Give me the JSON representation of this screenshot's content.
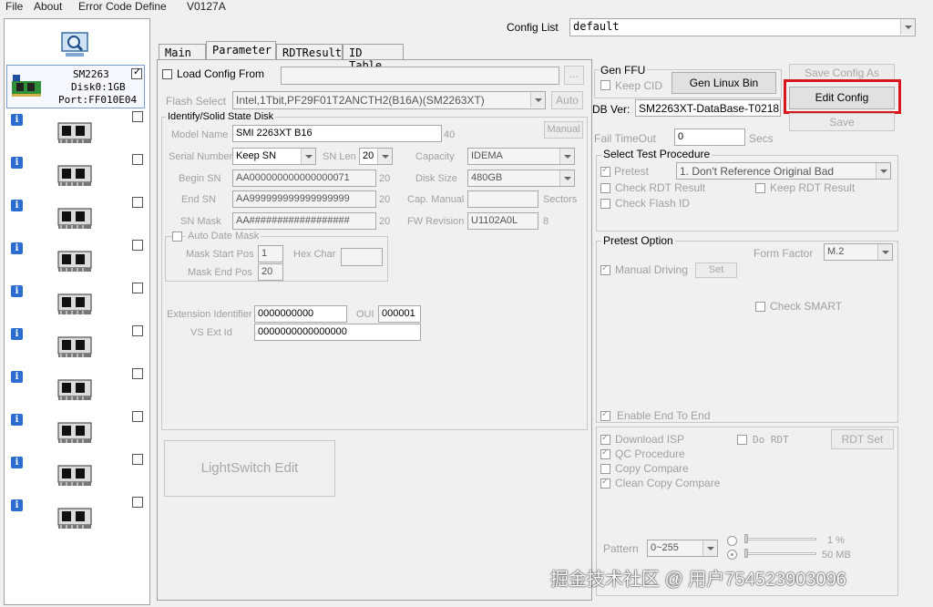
{
  "menu": {
    "file": "File",
    "about": "About",
    "error_code_define": "Error Code Define",
    "version": "V0127A"
  },
  "config_list": {
    "label": "Config List",
    "value": "default"
  },
  "left_panel": {
    "selected_port": {
      "line1": "SM2263",
      "line2": "Disk0:1GB",
      "line3": "Port:FF010E04"
    },
    "port_count": 11
  },
  "tabs": [
    "Main",
    "Parameter",
    "RDTResult",
    "ID Table"
  ],
  "load_config": {
    "label": "Load Config From",
    "browse": "..."
  },
  "flash_select": {
    "label": "Flash Select",
    "value": "Intel,1Tbit,PF29F01T2ANCTH2(B16A)(SM2263XT)",
    "auto": "Auto"
  },
  "identify": {
    "group_title": "Identify/Solid State Disk",
    "model_name_label": "Model Name",
    "model_name_value": "SMI 2263XT B16",
    "model_name_len": "40",
    "manual_btn": "Manual",
    "serial_number_label": "Serial Number",
    "serial_number_value": "Keep SN",
    "sn_len_label": "SN Len",
    "sn_len_value": "20",
    "capacity_label": "Capacity",
    "capacity_value": "IDEMA",
    "begin_sn_label": "Begin SN",
    "begin_sn_value": "AA000000000000000071",
    "begin_sn_len": "20",
    "disk_size_label": "Disk Size",
    "disk_size_value": "480GB",
    "end_sn_label": "End SN",
    "end_sn_value": "AA999999999999999999",
    "end_sn_len": "20",
    "cap_manual_label": "Cap. Manual",
    "cap_manual_unit": "Sectors",
    "sn_mask_label": "SN Mask",
    "sn_mask_value": "AA##################",
    "sn_mask_len": "20",
    "fw_revision_label": "FW Revision",
    "fw_revision_value": "U1102A0L",
    "fw_revision_len": "8",
    "auto_date_mask_label": "Auto Date Mask",
    "mask_start_pos_label": "Mask Start Pos",
    "mask_start_pos_value": "1",
    "hex_char_label": "Hex Char",
    "mask_end_pos_label": "Mask End Pos",
    "mask_end_pos_value": "20",
    "extension_identifier_label": "Extension Identifier",
    "extension_identifier_value": "0000000000",
    "oui_label": "OUI",
    "oui_value": "000001",
    "vs_ext_id_label": "VS Ext Id",
    "vs_ext_id_value": "0000000000000000"
  },
  "lightswitch_edit": "LightSwitch Edit",
  "gen_ffu": {
    "title": "Gen FFU",
    "keep_cid": "Keep CID",
    "gen_linux_bin": "Gen Linux Bin"
  },
  "db_ver": {
    "label": "DB Ver:",
    "value": "SM2263XT-DataBase-T0218"
  },
  "config_buttons": {
    "save_config_as": "Save Config As",
    "edit_config": "Edit Config",
    "save": "Save"
  },
  "fail_timeout": {
    "label": "Fail TimeOut",
    "value": "0",
    "unit": "Secs"
  },
  "test_procedure": {
    "title": "Select Test Procedure",
    "pretest": "Pretest",
    "pretest_option_value": "1. Don't Reference Original Bad",
    "check_rdt_result": "Check RDT Result",
    "keep_rdt_result": "Keep RDT Result",
    "check_flash_id": "Check Flash ID"
  },
  "pretest_option": {
    "title": "Pretest Option",
    "form_factor_label": "Form Factor",
    "form_factor_value": "M.2",
    "manual_driving": "Manual Driving",
    "set_btn": "Set",
    "check_smart": "Check SMART",
    "enable_end_to_end": "Enable End To End"
  },
  "bottom_options": {
    "download_isp": "Download ISP",
    "do_rdt": "Do RDT",
    "rdt_set": "RDT Set",
    "qc_procedure": "QC Procedure",
    "copy_compare": "Copy Compare",
    "clean_copy_compare": "Clean Copy Compare",
    "pattern_label": "Pattern",
    "pattern_value": "0~255",
    "slider1_value": "1 %",
    "slider2_value": "50 MB"
  },
  "watermark": "掘金技术社区 @ 用户754523903096",
  "colors": {
    "highlight_box": "#d9161c",
    "info_icon": "#2b6cd0"
  }
}
